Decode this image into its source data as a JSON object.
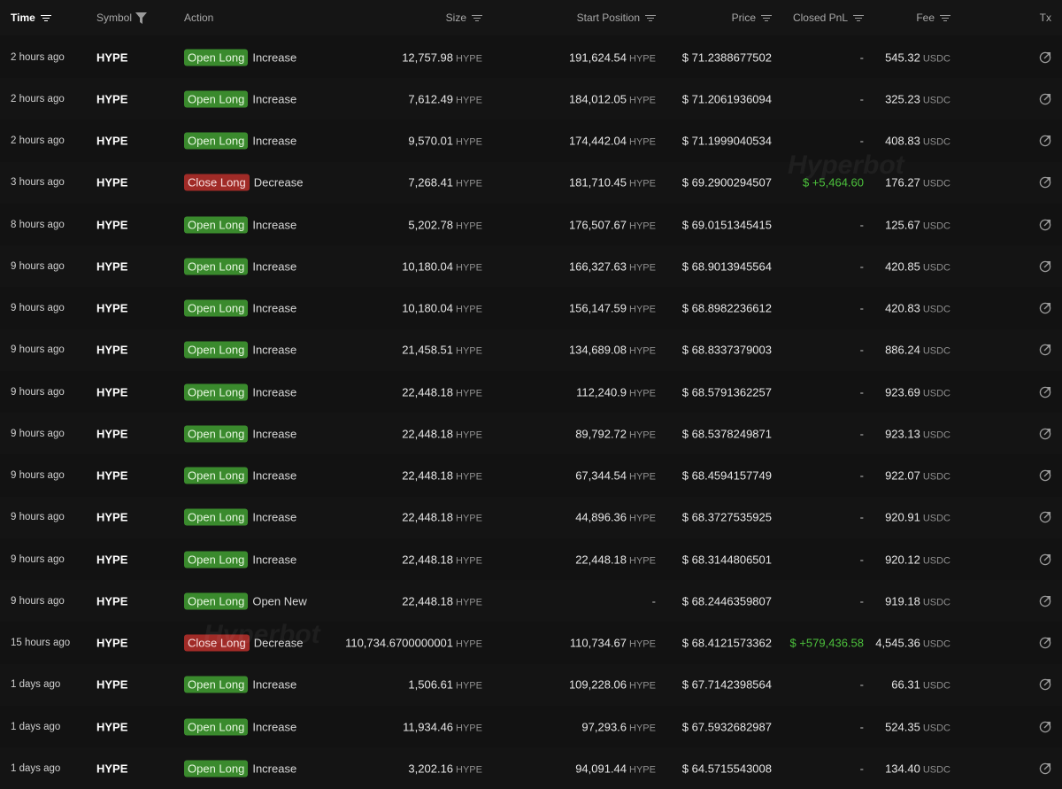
{
  "headers": {
    "time": "Time",
    "symbol": "Symbol",
    "action": "Action",
    "size": "Size",
    "start_position": "Start Position",
    "price": "Price",
    "closed_pnl": "Closed PnL",
    "fee": "Fee",
    "tx": "Tx"
  },
  "watermark": "Hyperbot",
  "colors": {
    "open_badge": "#3a8a2d",
    "close_badge": "#a02b27",
    "pnl_positive": "#4cc13c"
  },
  "rows": [
    {
      "time": "2 hours ago",
      "symbol": "HYPE",
      "badge": "Open Long",
      "badge_type": "open",
      "act": "Increase",
      "size": "12,757.98",
      "size_unit": "HYPE",
      "start": "191,624.54",
      "start_unit": "HYPE",
      "price": "$ 71.2388677502",
      "pnl": "-",
      "pnl_type": "none",
      "fee": "545.32",
      "fee_unit": "USDC"
    },
    {
      "time": "2 hours ago",
      "symbol": "HYPE",
      "badge": "Open Long",
      "badge_type": "open",
      "act": "Increase",
      "size": "7,612.49",
      "size_unit": "HYPE",
      "start": "184,012.05",
      "start_unit": "HYPE",
      "price": "$ 71.2061936094",
      "pnl": "-",
      "pnl_type": "none",
      "fee": "325.23",
      "fee_unit": "USDC"
    },
    {
      "time": "2 hours ago",
      "symbol": "HYPE",
      "badge": "Open Long",
      "badge_type": "open",
      "act": "Increase",
      "size": "9,570.01",
      "size_unit": "HYPE",
      "start": "174,442.04",
      "start_unit": "HYPE",
      "price": "$ 71.1999040534",
      "pnl": "-",
      "pnl_type": "none",
      "fee": "408.83",
      "fee_unit": "USDC"
    },
    {
      "time": "3 hours ago",
      "symbol": "HYPE",
      "badge": "Close Long",
      "badge_type": "close",
      "act": "Decrease",
      "size": "7,268.41",
      "size_unit": "HYPE",
      "start": "181,710.45",
      "start_unit": "HYPE",
      "price": "$ 69.2900294507",
      "pnl": "$ +5,464.60",
      "pnl_type": "pos",
      "fee": "176.27",
      "fee_unit": "USDC"
    },
    {
      "time": "8 hours ago",
      "symbol": "HYPE",
      "badge": "Open Long",
      "badge_type": "open",
      "act": "Increase",
      "size": "5,202.78",
      "size_unit": "HYPE",
      "start": "176,507.67",
      "start_unit": "HYPE",
      "price": "$ 69.0151345415",
      "pnl": "-",
      "pnl_type": "none",
      "fee": "125.67",
      "fee_unit": "USDC"
    },
    {
      "time": "9 hours ago",
      "symbol": "HYPE",
      "badge": "Open Long",
      "badge_type": "open",
      "act": "Increase",
      "size": "10,180.04",
      "size_unit": "HYPE",
      "start": "166,327.63",
      "start_unit": "HYPE",
      "price": "$ 68.9013945564",
      "pnl": "-",
      "pnl_type": "none",
      "fee": "420.85",
      "fee_unit": "USDC"
    },
    {
      "time": "9 hours ago",
      "symbol": "HYPE",
      "badge": "Open Long",
      "badge_type": "open",
      "act": "Increase",
      "size": "10,180.04",
      "size_unit": "HYPE",
      "start": "156,147.59",
      "start_unit": "HYPE",
      "price": "$ 68.8982236612",
      "pnl": "-",
      "pnl_type": "none",
      "fee": "420.83",
      "fee_unit": "USDC"
    },
    {
      "time": "9 hours ago",
      "symbol": "HYPE",
      "badge": "Open Long",
      "badge_type": "open",
      "act": "Increase",
      "size": "21,458.51",
      "size_unit": "HYPE",
      "start": "134,689.08",
      "start_unit": "HYPE",
      "price": "$ 68.8337379003",
      "pnl": "-",
      "pnl_type": "none",
      "fee": "886.24",
      "fee_unit": "USDC"
    },
    {
      "time": "9 hours ago",
      "symbol": "HYPE",
      "badge": "Open Long",
      "badge_type": "open",
      "act": "Increase",
      "size": "22,448.18",
      "size_unit": "HYPE",
      "start": "112,240.9",
      "start_unit": "HYPE",
      "price": "$ 68.5791362257",
      "pnl": "-",
      "pnl_type": "none",
      "fee": "923.69",
      "fee_unit": "USDC"
    },
    {
      "time": "9 hours ago",
      "symbol": "HYPE",
      "badge": "Open Long",
      "badge_type": "open",
      "act": "Increase",
      "size": "22,448.18",
      "size_unit": "HYPE",
      "start": "89,792.72",
      "start_unit": "HYPE",
      "price": "$ 68.5378249871",
      "pnl": "-",
      "pnl_type": "none",
      "fee": "923.13",
      "fee_unit": "USDC"
    },
    {
      "time": "9 hours ago",
      "symbol": "HYPE",
      "badge": "Open Long",
      "badge_type": "open",
      "act": "Increase",
      "size": "22,448.18",
      "size_unit": "HYPE",
      "start": "67,344.54",
      "start_unit": "HYPE",
      "price": "$ 68.4594157749",
      "pnl": "-",
      "pnl_type": "none",
      "fee": "922.07",
      "fee_unit": "USDC"
    },
    {
      "time": "9 hours ago",
      "symbol": "HYPE",
      "badge": "Open Long",
      "badge_type": "open",
      "act": "Increase",
      "size": "22,448.18",
      "size_unit": "HYPE",
      "start": "44,896.36",
      "start_unit": "HYPE",
      "price": "$ 68.3727535925",
      "pnl": "-",
      "pnl_type": "none",
      "fee": "920.91",
      "fee_unit": "USDC"
    },
    {
      "time": "9 hours ago",
      "symbol": "HYPE",
      "badge": "Open Long",
      "badge_type": "open",
      "act": "Increase",
      "size": "22,448.18",
      "size_unit": "HYPE",
      "start": "22,448.18",
      "start_unit": "HYPE",
      "price": "$ 68.3144806501",
      "pnl": "-",
      "pnl_type": "none",
      "fee": "920.12",
      "fee_unit": "USDC"
    },
    {
      "time": "9 hours ago",
      "symbol": "HYPE",
      "badge": "Open Long",
      "badge_type": "open",
      "act": "Open New",
      "size": "22,448.18",
      "size_unit": "HYPE",
      "start": "-",
      "start_unit": "",
      "price": "$ 68.2446359807",
      "pnl": "-",
      "pnl_type": "none",
      "fee": "919.18",
      "fee_unit": "USDC"
    },
    {
      "time": "15 hours ago",
      "symbol": "HYPE",
      "badge": "Close Long",
      "badge_type": "close",
      "act": "Decrease",
      "size": "110,734.6700000001",
      "size_unit": "HYPE",
      "start": "110,734.67",
      "start_unit": "HYPE",
      "price": "$ 68.4121573362",
      "pnl": "$ +579,436.58",
      "pnl_type": "pos",
      "fee": "4,545.36",
      "fee_unit": "USDC"
    },
    {
      "time": "1 days ago",
      "symbol": "HYPE",
      "badge": "Open Long",
      "badge_type": "open",
      "act": "Increase",
      "size": "1,506.61",
      "size_unit": "HYPE",
      "start": "109,228.06",
      "start_unit": "HYPE",
      "price": "$ 67.7142398564",
      "pnl": "-",
      "pnl_type": "none",
      "fee": "66.31",
      "fee_unit": "USDC"
    },
    {
      "time": "1 days ago",
      "symbol": "HYPE",
      "badge": "Open Long",
      "badge_type": "open",
      "act": "Increase",
      "size": "11,934.46",
      "size_unit": "HYPE",
      "start": "97,293.6",
      "start_unit": "HYPE",
      "price": "$ 67.5932682987",
      "pnl": "-",
      "pnl_type": "none",
      "fee": "524.35",
      "fee_unit": "USDC"
    },
    {
      "time": "1 days ago",
      "symbol": "HYPE",
      "badge": "Open Long",
      "badge_type": "open",
      "act": "Increase",
      "size": "3,202.16",
      "size_unit": "HYPE",
      "start": "94,091.44",
      "start_unit": "HYPE",
      "price": "$ 64.5715543008",
      "pnl": "-",
      "pnl_type": "none",
      "fee": "134.40",
      "fee_unit": "USDC"
    }
  ]
}
